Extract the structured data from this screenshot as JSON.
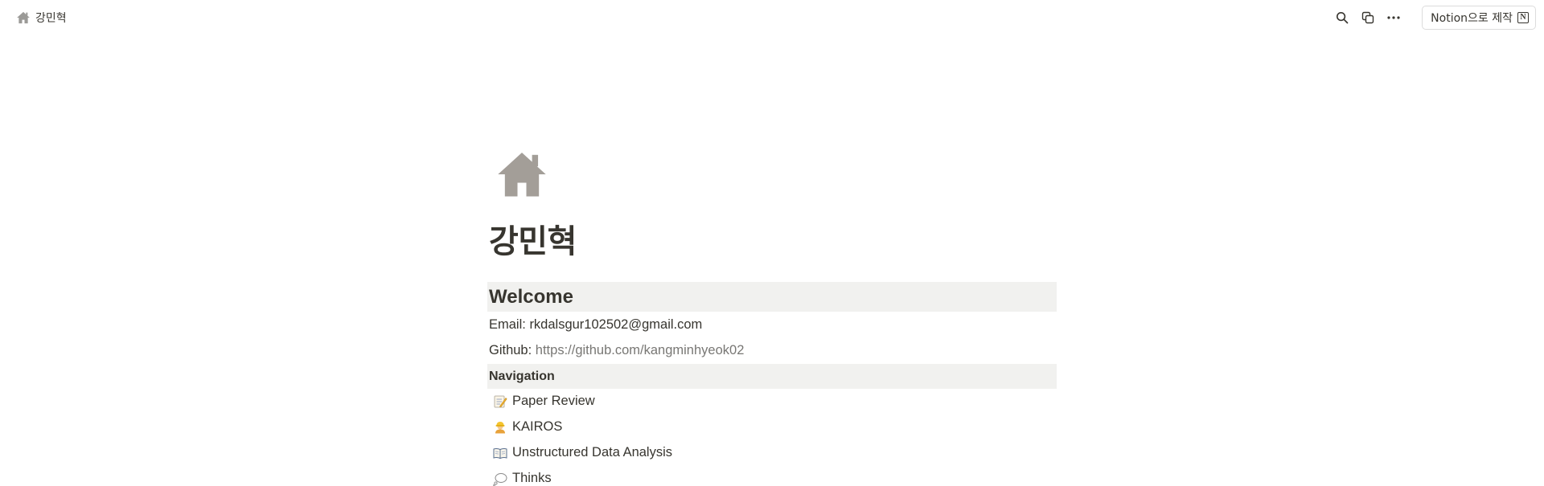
{
  "topbar": {
    "breadcrumb_label": "강민혁",
    "made_with_label": "Notion으로 제작",
    "icons": [
      "home-icon",
      "search-icon",
      "duplicate-icon",
      "more-icon",
      "notion-logo-icon"
    ]
  },
  "page": {
    "icon": "home-icon",
    "title": "강민혁"
  },
  "welcome": {
    "heading": "Welcome",
    "email_label": "Email:",
    "email_value": "rkdalsgur102502@gmail.com",
    "github_label": "Github:",
    "github_link": "https://github.com/kangminhyeok02"
  },
  "navigation": {
    "heading": "Navigation",
    "items": [
      {
        "label": "Paper Review",
        "icon": "memo-icon"
      },
      {
        "label": "KAIROS",
        "icon": "construction-worker-icon"
      },
      {
        "label": "Unstructured Data Analysis",
        "icon": "open-book-icon"
      },
      {
        "label": "Thinks",
        "icon": "thought-bubble-icon"
      }
    ]
  },
  "colors": {
    "text": "#37352f",
    "callout_background": "#f1f1ef",
    "link": "#787774",
    "icon_gray": "#9b9a97"
  }
}
